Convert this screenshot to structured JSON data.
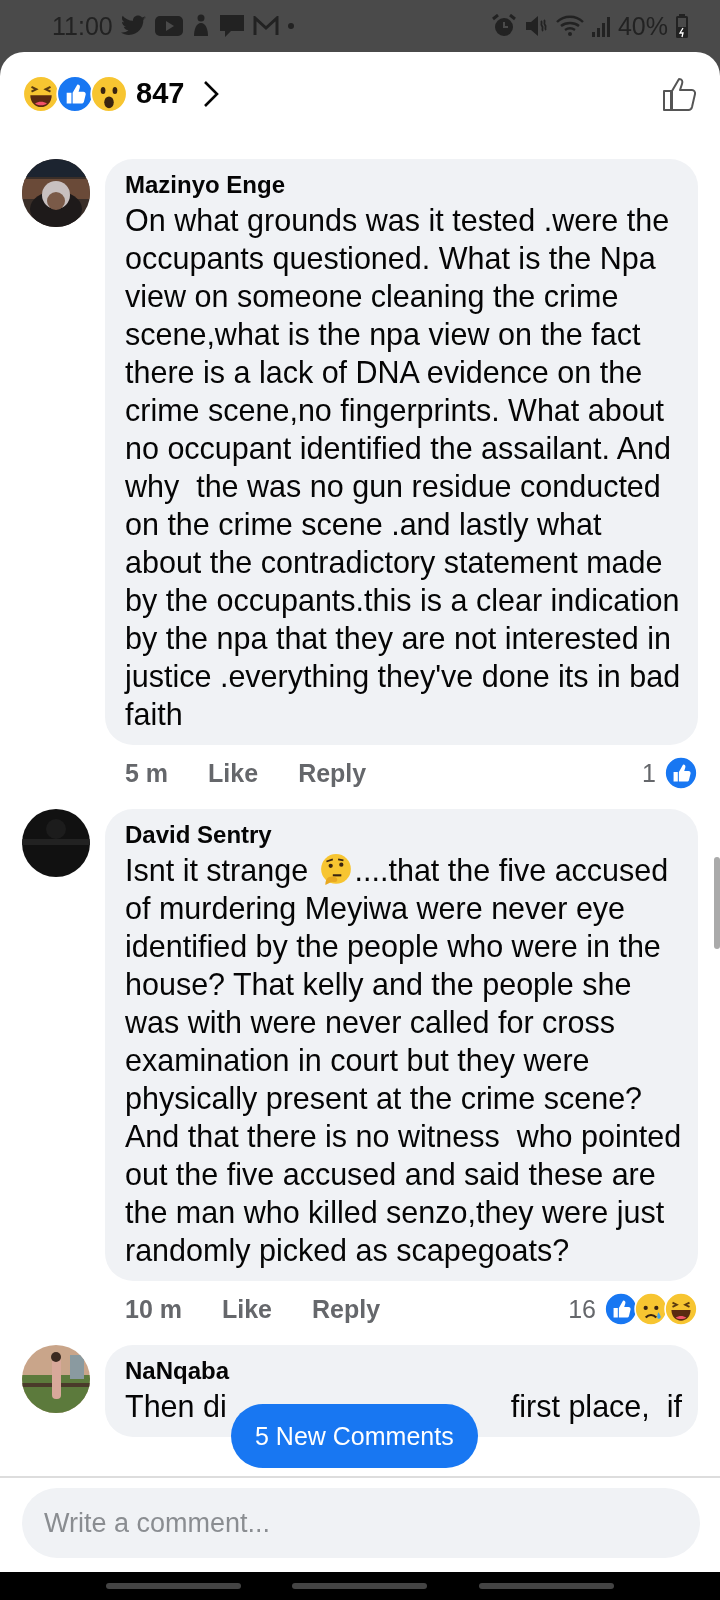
{
  "status_bar": {
    "time": "11:00",
    "battery": "40%"
  },
  "header": {
    "reactions": [
      {
        "kind": "haha"
      },
      {
        "kind": "like"
      },
      {
        "kind": "wow"
      }
    ],
    "count": "847"
  },
  "comments": [
    {
      "kind": "full",
      "author": "Mazinyo Enge",
      "segments": [
        {
          "kind": "paragraph",
          "text": "On what grounds was it tested .were the occupants questioned. What is the Npa view on someone cleaning the crime scene,what is the npa view on the fact there is a lack of DNA evidence on the crime scene,no fingerprints. What about no occupant identified the assailant. And why  the was no gun residue conducted on the crime scene .and lastly what about the contradictory statement made by the occupants.this is a clear indication by the npa that they are not interested in justice .everything they've done its in bad faith"
        }
      ],
      "time": "5 m",
      "like": "Like",
      "reply": "Reply",
      "reaction_count": "1",
      "reactions": [
        {
          "kind": "like"
        }
      ]
    },
    {
      "kind": "full",
      "author": "David Sentry",
      "segments": [
        {
          "kind": "text",
          "text": "Isnt it strange "
        },
        {
          "kind": "emoji"
        },
        {
          "kind": "text",
          "text": "....that the five accused"
        },
        {
          "kind": "paragraph",
          "text": "of murdering Meyiwa were never eye identified by the people who were in the house? That kelly and the people she was with were never called for cross examination in court but they were physically present at the crime scene? And that there is no witness  who pointed out the five accused and said these are the man who killed senzo,they were just randomly picked as scapegoats?"
        }
      ],
      "time": "10 m",
      "like": "Like",
      "reply": "Reply",
      "reaction_count": "16",
      "reactions": [
        {
          "kind": "like"
        },
        {
          "kind": "sad"
        },
        {
          "kind": "haha"
        }
      ]
    },
    {
      "kind": "partial",
      "author": "NaNqaba",
      "segments": [
        {
          "kind": "text",
          "text": "Then di"
        },
        {
          "kind": "text",
          "text": "first place,  if"
        }
      ]
    }
  ],
  "new_comments_button": "5 New Comments",
  "composer": {
    "placeholder": "Write a comment..."
  }
}
